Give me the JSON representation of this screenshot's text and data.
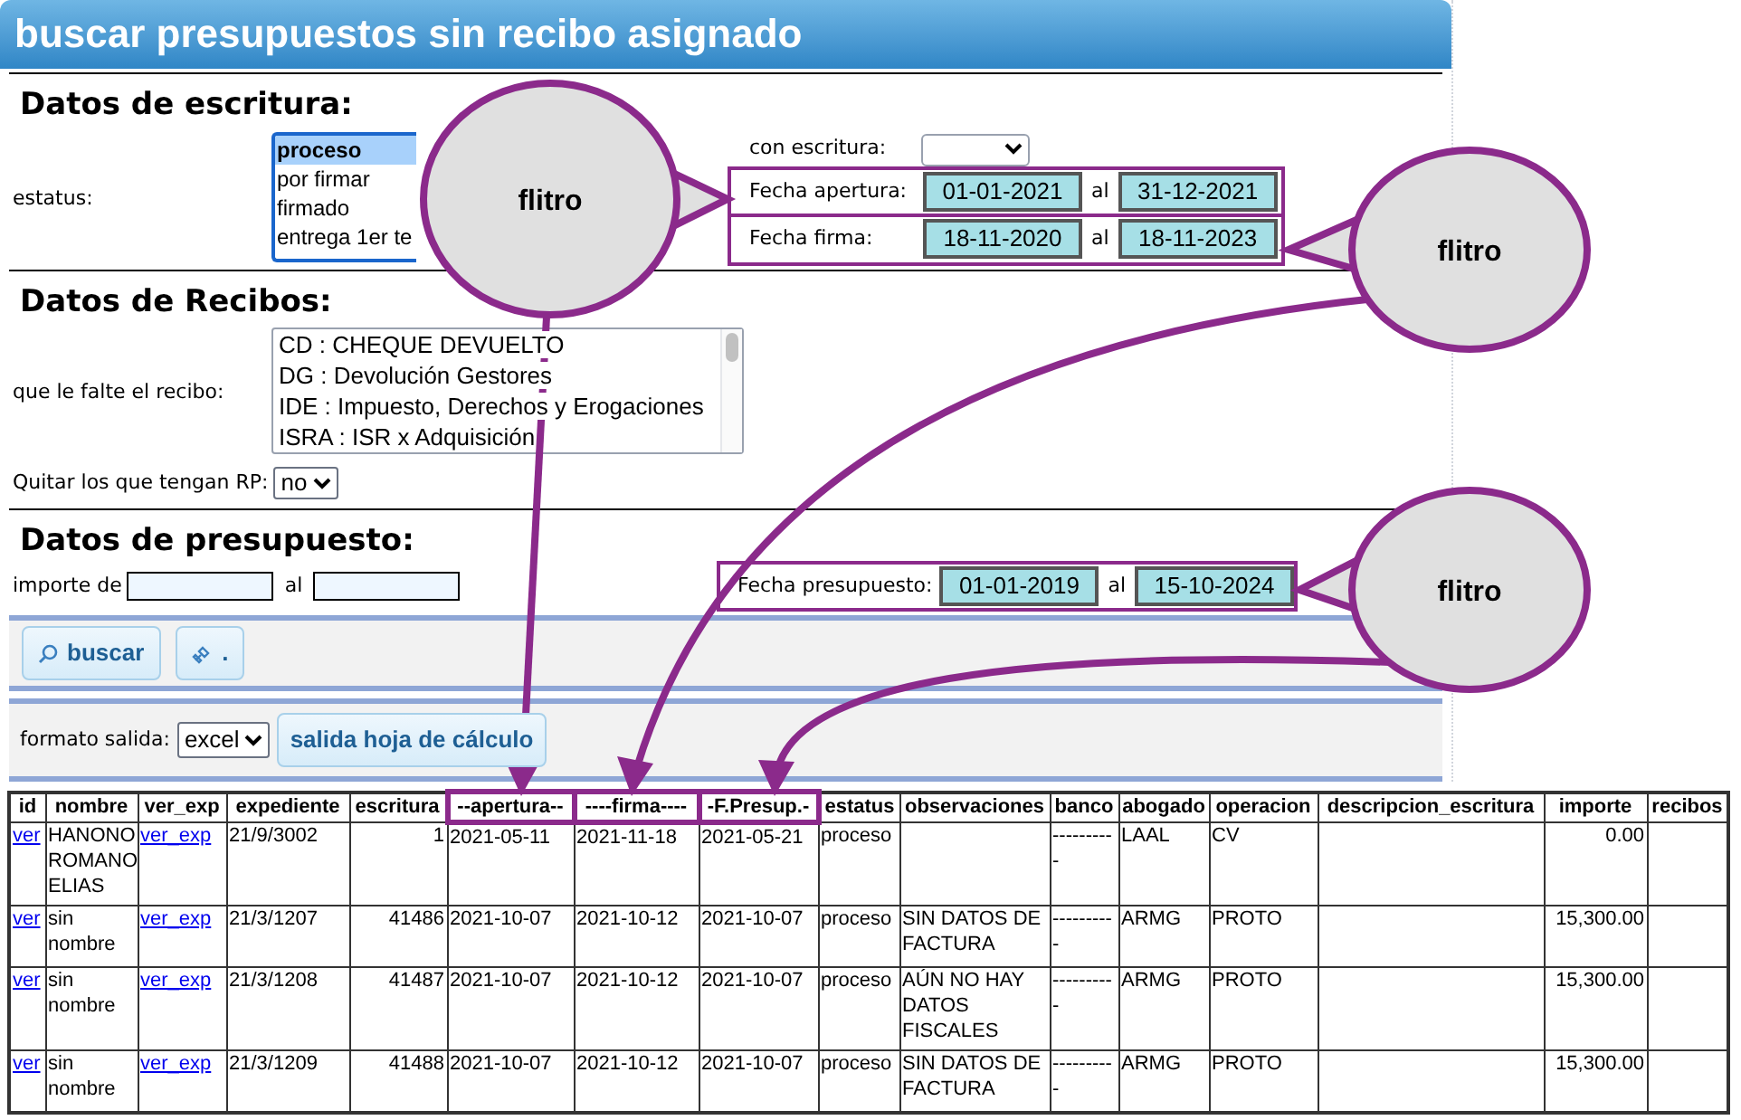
{
  "title": "buscar presupuestos sin recibo asignado",
  "escritura": {
    "heading": "Datos de escritura:",
    "status_label": "estatus:",
    "status_options": [
      {
        "label": "proceso",
        "selected": true
      },
      {
        "label": "por firmar",
        "selected": false
      },
      {
        "label": "firmado",
        "selected": false
      },
      {
        "label": "entrega 1er te",
        "selected": false
      }
    ],
    "con_escritura_label": "con escritura:",
    "date_filters": [
      {
        "label": "Fecha apertura:",
        "from": "01-01-2021",
        "joiner": "al",
        "to": "31-12-2021"
      },
      {
        "label": "Fecha firma:",
        "from": "18-11-2020",
        "joiner": "al",
        "to": "18-11-2023"
      }
    ]
  },
  "recibos": {
    "heading": "Datos de Recibos:",
    "missing_label": "que le falte el recibo:",
    "options": [
      "CD : CHEQUE DEVUELTO",
      "DG : Devolución Gestores",
      "IDE : Impuesto, Derechos y Erogaciones",
      "ISRA : ISR x Adquisición"
    ],
    "quitar_label": "Quitar los que tengan RP:",
    "quitar_value": "no"
  },
  "presupuesto": {
    "heading": "Datos de presupuesto:",
    "importe_label": "importe de",
    "importe_joiner": "al",
    "date_filter": {
      "label": "Fecha presupuesto:",
      "from": "01-01-2019",
      "joiner": "al",
      "to": "15-10-2024"
    }
  },
  "buttons": {
    "search": "buscar",
    "link": "."
  },
  "export": {
    "format_label": "formato salida:",
    "format_value": "excel",
    "button": "salida hoja de cálculo"
  },
  "table": {
    "columns": [
      {
        "label": "id",
        "highlighted": false,
        "link": true
      },
      {
        "label": "nombre",
        "highlighted": false,
        "link": false
      },
      {
        "label": "ver_exp",
        "highlighted": false,
        "link": true
      },
      {
        "label": "expediente",
        "highlighted": false,
        "link": false
      },
      {
        "label": "escritura",
        "highlighted": false,
        "link": false
      },
      {
        "label": "--apertura--",
        "highlighted": true,
        "link": false
      },
      {
        "label": "----firma----",
        "highlighted": true,
        "link": false
      },
      {
        "label": "-F.Presup.-",
        "highlighted": true,
        "link": false
      },
      {
        "label": "estatus",
        "highlighted": false,
        "link": false
      },
      {
        "label": "observaciones",
        "highlighted": false,
        "link": false
      },
      {
        "label": "banco",
        "highlighted": false,
        "link": false
      },
      {
        "label": "abogado",
        "highlighted": false,
        "link": false
      },
      {
        "label": "operacion",
        "highlighted": false,
        "link": false
      },
      {
        "label": "descripcion_escritura",
        "highlighted": false,
        "link": false
      },
      {
        "label": "importe",
        "highlighted": false,
        "link": false
      },
      {
        "label": "recibos",
        "highlighted": false,
        "link": false
      }
    ],
    "rows": [
      [
        "ver",
        "HANONO ROMANO ELIAS",
        "ver_exp",
        "21/9/3002",
        "1",
        "2021-05-11",
        "2021-11-18",
        "2021-05-21",
        "proceso",
        "",
        "----------",
        "LAAL",
        "CV",
        "",
        "0.00",
        ""
      ],
      [
        "ver",
        "sin nombre",
        "ver_exp",
        "21/3/1207",
        "41486",
        "2021-10-07",
        "2021-10-12",
        "2021-10-07",
        "proceso",
        "SIN DATOS DE FACTURA",
        "----------",
        "ARMG",
        "PROTO",
        "",
        "15,300.00",
        ""
      ],
      [
        "ver",
        "sin nombre",
        "ver_exp",
        "21/3/1208",
        "41487",
        "2021-10-07",
        "2021-10-12",
        "2021-10-07",
        "proceso",
        "AÚN NO HAY DATOS FISCALES",
        "----------",
        "ARMG",
        "PROTO",
        "",
        "15,300.00",
        ""
      ],
      [
        "ver",
        "sin nombre",
        "ver_exp",
        "21/3/1209",
        "41488",
        "2021-10-07",
        "2021-10-12",
        "2021-10-07",
        "proceso",
        "SIN DATOS DE FACTURA",
        "----------",
        "ARMG",
        "PROTO",
        "",
        "15,300.00",
        ""
      ]
    ]
  },
  "callouts": [
    {
      "text": "flitro"
    },
    {
      "text": "flitro"
    },
    {
      "text": "flitro"
    }
  ]
}
